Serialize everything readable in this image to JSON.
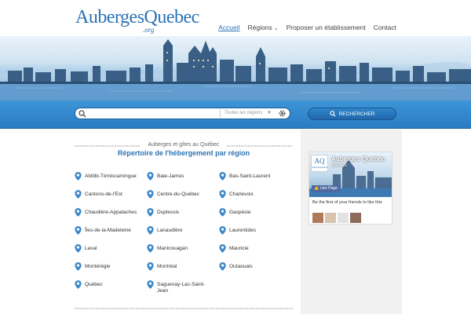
{
  "header": {
    "logo_main": "AubergesQuebec",
    "logo_suffix": ".org",
    "nav": [
      {
        "label": "Accueil",
        "active": true
      },
      {
        "label": "Régions",
        "dropdown": true
      },
      {
        "label": "Proposer un établissement"
      },
      {
        "label": "Contact"
      }
    ]
  },
  "search": {
    "placeholder": "",
    "region_select": "Toutes les régions",
    "button_label": "RECHERCHER"
  },
  "main": {
    "subtitle": "Auberges et gîtes au Québec",
    "title": "Répertoire de l'hébergement par région",
    "regions": [
      "Abitibi-Témiscamingue",
      "Baie-James",
      "Bas-Saint-Laurent",
      "Cantons-de-l'Est",
      "Centre-du-Québec",
      "Charlevoix",
      "Chaudière-Appalaches",
      "Duplessis",
      "Gaspésie",
      "Îles-de-la-Madeleine",
      "Lanaudière",
      "Laurentides",
      "Laval",
      "Manicouagan",
      "Mauricie",
      "Montérégie",
      "Montréal",
      "Outaouais",
      "Québec",
      "Saguenay-Lac-Saint-Jean"
    ]
  },
  "facebook": {
    "page_name": "Auberges Quebec",
    "likes": "183 likes",
    "like_button": "Like Page",
    "friends_text": "Be the first of your friends to like this",
    "logo_text": "AQ",
    "logo_sub": "AubergesQuebec"
  },
  "colors": {
    "accent": "#2a72b5",
    "band": "#2b7cc2"
  }
}
